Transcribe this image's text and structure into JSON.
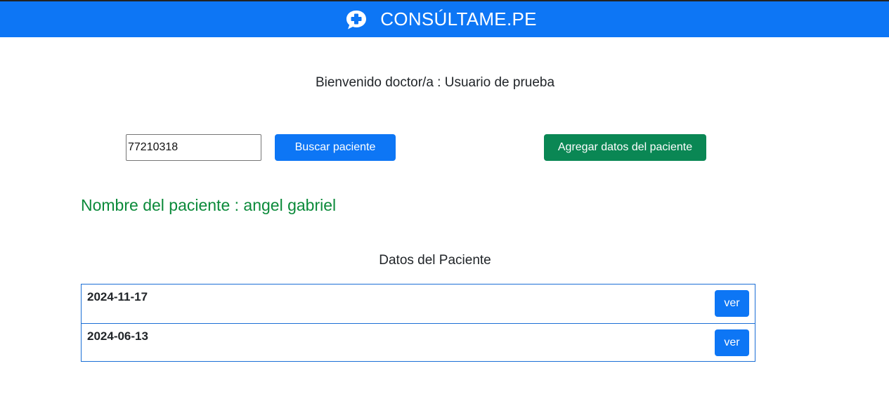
{
  "header": {
    "brand": "CONSÚLTAME.PE",
    "logo_icon": "medical-chat-plus-icon",
    "color": "#0d76f5"
  },
  "welcome": "Bienvenido doctor/a : Usuario de prueba",
  "search": {
    "value": "77210318",
    "button_label": "Buscar paciente"
  },
  "add_button_label": "Agregar datos del paciente",
  "patient_name": "Nombre del paciente : angel gabriel",
  "section_title": "Datos del Paciente",
  "records": [
    {
      "date": "2024-11-17",
      "button_label": "ver"
    },
    {
      "date": "2024-06-13",
      "button_label": "ver"
    }
  ],
  "colors": {
    "primary": "#0d76f5",
    "success": "#0a8754",
    "patient_name": "#0b8a3a"
  }
}
